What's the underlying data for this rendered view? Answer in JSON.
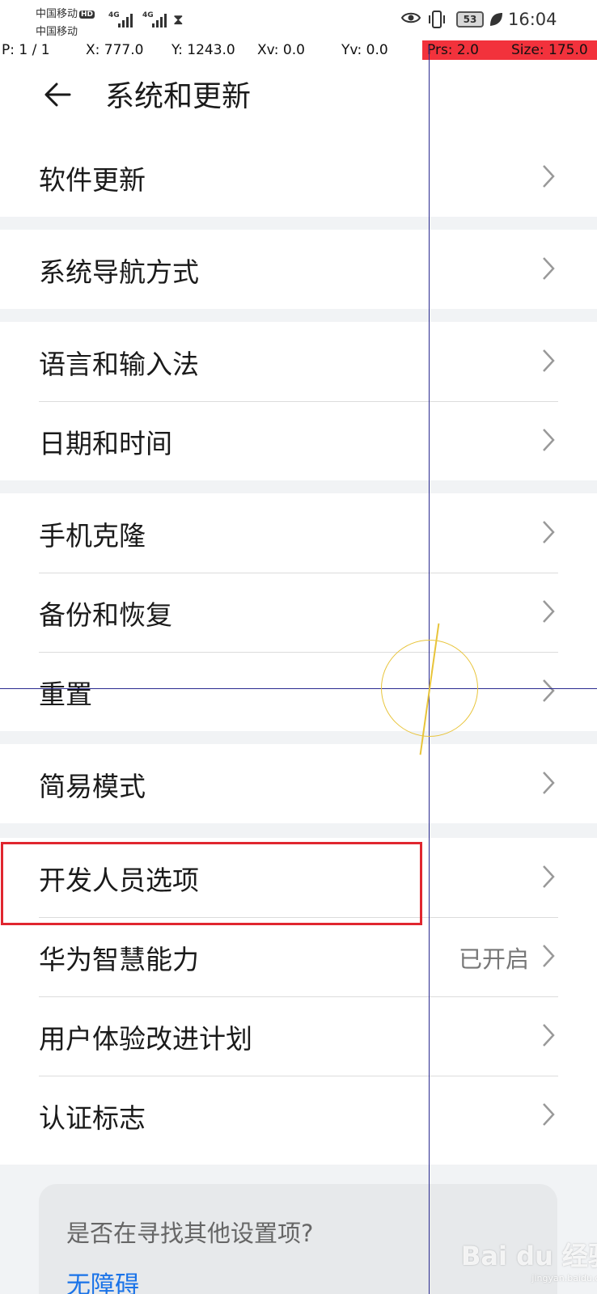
{
  "status_bar": {
    "carrier_1": "中国移动",
    "hd_badge": "HD",
    "carrier_2": "中国移动",
    "network_1": "4G",
    "network_2": "4G",
    "battery_level": "53",
    "time": "16:04"
  },
  "debug_overlay": {
    "pointer": "P: 1 / 1",
    "x": "X: 777.0",
    "y": "Y: 1243.0",
    "xv": "Xv: 0.0",
    "yv": "Yv: 0.0",
    "prs": "Prs: 2.0",
    "size": "Size: 175.0"
  },
  "header": {
    "title": "系统和更新"
  },
  "sections": [
    {
      "items": [
        {
          "label": "软件更新"
        }
      ]
    },
    {
      "items": [
        {
          "label": "系统导航方式"
        }
      ]
    },
    {
      "items": [
        {
          "label": "语言和输入法"
        },
        {
          "label": "日期和时间"
        }
      ]
    },
    {
      "items": [
        {
          "label": "手机克隆"
        },
        {
          "label": "备份和恢复"
        },
        {
          "label": "重置"
        }
      ]
    },
    {
      "items": [
        {
          "label": "简易模式"
        }
      ]
    },
    {
      "items": [
        {
          "label": "开发人员选项"
        },
        {
          "label": "华为智慧能力",
          "value": "已开启"
        },
        {
          "label": "用户体验改进计划"
        },
        {
          "label": "认证标志"
        }
      ]
    }
  ],
  "suggestion": {
    "title": "是否在寻找其他设置项?",
    "link": "无障碍"
  },
  "watermark": {
    "text": "Bai du 经验",
    "sub": "jingyan.baidu.com"
  },
  "colors": {
    "highlight": "#e0262f",
    "link": "#1a73e8",
    "debug_red": "#f2323c",
    "crosshair": "#2a2a90"
  }
}
